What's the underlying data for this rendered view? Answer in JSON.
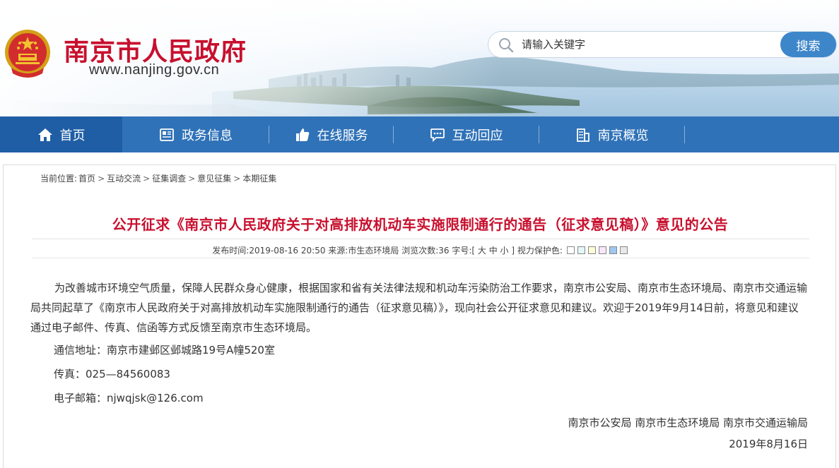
{
  "header": {
    "site_title": "南京市人民政府",
    "site_url": "www.nanjing.gov.cn",
    "search_placeholder": "请输入关键字",
    "search_button": "搜索"
  },
  "nav": {
    "items": [
      {
        "label": "首页",
        "icon": "home-icon"
      },
      {
        "label": "政务信息",
        "icon": "newspaper-icon"
      },
      {
        "label": "在线服务",
        "icon": "thumbs-up-icon"
      },
      {
        "label": "互动回应",
        "icon": "chat-icon"
      },
      {
        "label": "南京概览",
        "icon": "building-icon"
      }
    ]
  },
  "breadcrumb": {
    "prefix": "当前位置:",
    "items": [
      "首页",
      "互动交流",
      "征集调查",
      "意见征集",
      "本期征集"
    ],
    "separator": ">"
  },
  "article": {
    "title": "公开征求《南京市人民政府关于对高排放机动车实施限制通行的通告（征求意见稿）》意见的公告",
    "meta": {
      "publish_label": "发布时间:",
      "publish_time": "2019-08-16 20:50",
      "source_label": "来源:",
      "source": "市生态环境局",
      "views_label": "浏览次数:",
      "views": "36",
      "font_label": "字号:",
      "font_sizes": "[ 大 中 小 ]",
      "eye_label": "视力保护色:",
      "eye_colors": [
        "#ffffff",
        "#e6f7f7",
        "#fcfcd7",
        "#f9e6f9",
        "#9dc8f0",
        "#e8e8e8"
      ]
    },
    "paragraph": "为改善城市环境空气质量，保障人民群众身心健康，根据国家和省有关法律法规和机动车污染防治工作要求，南京市公安局、南京市生态环境局、南京市交通运输局共同起草了《南京市人民政府关于对高排放机动车实施限制通行的通告（征求意见稿）》，现向社会公开征求意见和建议。欢迎于2019年9月14日前，将意见和建议通过电子邮件、传真、信函等方式反馈至南京市生态环境局。",
    "address": "通信地址：南京市建邺区邺城路19号A幢520室",
    "fax": "传真：025—84560083",
    "email": "电子邮箱：njwqjsk@126.com",
    "signers": "南京市公安局 南京市生态环境局 南京市交通运输局",
    "date": "2019年8月16日"
  },
  "colors": {
    "brand_red": "#c8102e",
    "nav_blue": "#2f72b8",
    "nav_active": "#1f5ea5",
    "search_button": "#3d86c9"
  }
}
